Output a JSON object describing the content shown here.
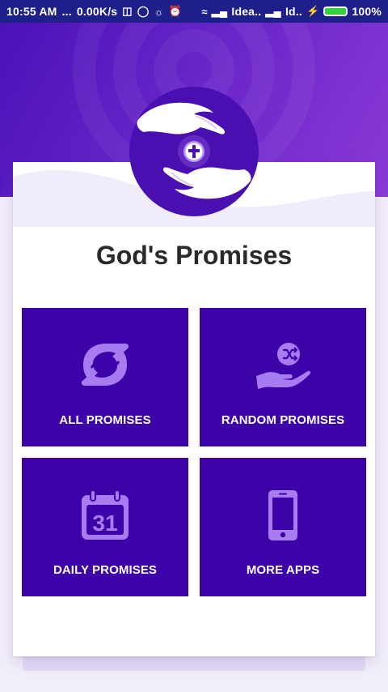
{
  "status_bar": {
    "time": "10:55 AM",
    "dots": "...",
    "network_speed": "0.00K/s",
    "carrier1": "Idea..",
    "carrier2": "Id..",
    "battery": "100%"
  },
  "app": {
    "title": "God's Promises"
  },
  "colors": {
    "header": "#6a26c9",
    "tile": "#3c04a8",
    "icon": "#a77cf0",
    "status_bar": "#1e1f8a"
  },
  "tiles": [
    {
      "label": "ALL PROMISES",
      "icon": "shuffle-arrows-icon"
    },
    {
      "label": "RANDOM PROMISES",
      "icon": "hand-shuffle-icon"
    },
    {
      "label": "DAILY PROMISES",
      "icon": "calendar-icon",
      "icon_text": "31"
    },
    {
      "label": "MORE APPS",
      "icon": "phone-icon"
    }
  ]
}
